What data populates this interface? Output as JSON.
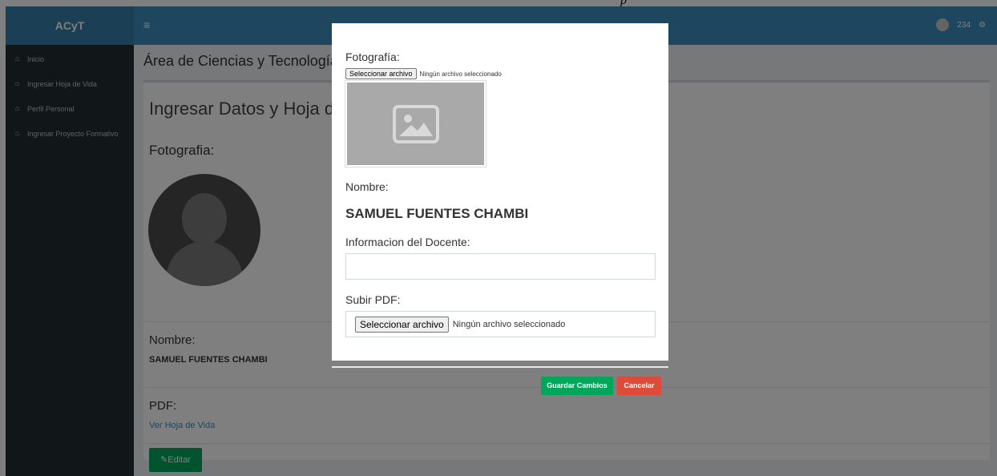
{
  "topstrip": {
    "mark": "p"
  },
  "navbar": {
    "brand": "ACyT",
    "menu_glyph": "≡",
    "user_number": "234",
    "settings_glyph": "⚙"
  },
  "sidebar": {
    "items": [
      {
        "label": "Inicio",
        "icon": "home-icon"
      },
      {
        "label": "Ingresar Hoja de Vida",
        "icon": "home-icon"
      },
      {
        "label": "Perfil Personal",
        "icon": "home-icon"
      },
      {
        "label": "Ingresar Proyecto Formativo",
        "icon": "home-icon"
      }
    ]
  },
  "content": {
    "header": "Área de Ciencias y Tecnología",
    "box_title": "Ingresar Datos y Hoja de V",
    "foto_label": "Fotografia:",
    "nombre_label": "Nombre:",
    "nombre_value": "SAMUEL FUENTES CHAMBI",
    "pdf_label": "PDF:",
    "pdf_link": "Ver Hoja de Vida",
    "edit_button": "Editar"
  },
  "modal": {
    "foto_label": "Fotografía:",
    "file_button_small": "Seleccionar archivo",
    "file_status_small": "Ningún archivo seleccionado",
    "nombre_label": "Nombre:",
    "nombre_value": "SAMUEL FUENTES CHAMBI",
    "info_label": "Informacion del Docente:",
    "info_value": "",
    "pdf_label": "Subir PDF:",
    "file_button_big": "Seleccionar archivo",
    "file_status_big": "Ningún archivo seleccionado",
    "save_button": "Guardar Cambios",
    "cancel_button": "Cancelar"
  },
  "colors": {
    "navbar": "#3c8dbc",
    "sidebar": "#222d32",
    "success": "#00a65a",
    "danger": "#dd4b39"
  }
}
